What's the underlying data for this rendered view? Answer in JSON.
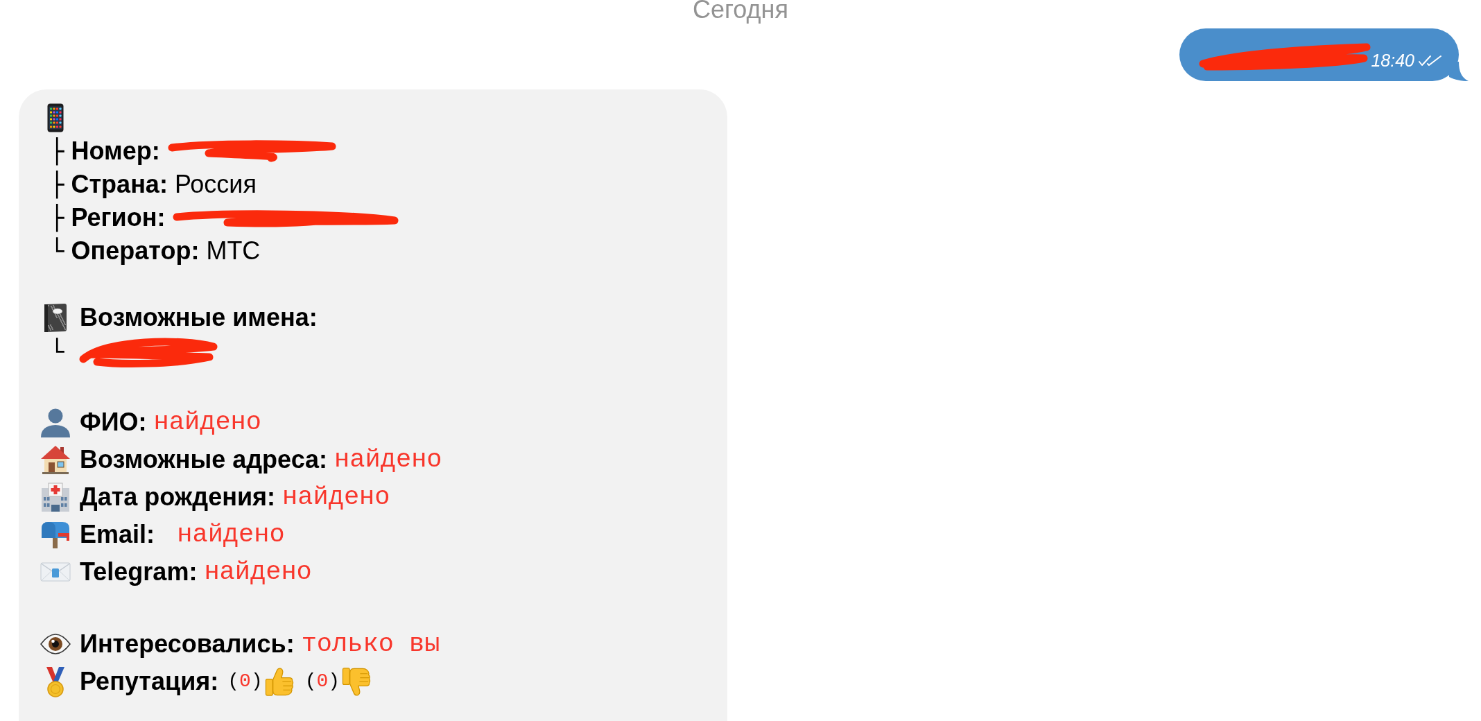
{
  "date_header": "Сегодня",
  "outgoing_message": {
    "redacted": true,
    "time": "18:40",
    "read": true
  },
  "incoming_message": {
    "phone_section": {
      "rows": [
        {
          "branch": "├",
          "label": "Номер:",
          "redacted": true
        },
        {
          "branch": "├",
          "label": "Страна:",
          "value": "Россия",
          "redacted": false
        },
        {
          "branch": "├",
          "label": "Регион:",
          "redacted": true
        },
        {
          "branch": "└",
          "label": "Оператор:",
          "value": "МТС",
          "redacted": false
        }
      ]
    },
    "names_section": {
      "title": "Возможные имена:",
      "rows": [
        {
          "branch": "└",
          "redacted": true
        }
      ]
    },
    "found_section": {
      "rows": [
        {
          "label": "ФИО:",
          "value": "найдено"
        },
        {
          "label": "Возможные адреса:",
          "value": "найдено"
        },
        {
          "label": "Дата рождения:",
          "value": "найдено"
        },
        {
          "label": "Email:",
          "value": " найдено"
        },
        {
          "label": "Telegram:",
          "value": "найдено"
        }
      ]
    },
    "viewers": {
      "label": "Интересовались:",
      "value": "только вы"
    },
    "reputation": {
      "label": "Репутация:",
      "votes": [
        {
          "open": "(",
          "count": "0",
          "close": ")"
        },
        {
          "open": "(",
          "count": "0",
          "close": ")"
        }
      ]
    }
  }
}
